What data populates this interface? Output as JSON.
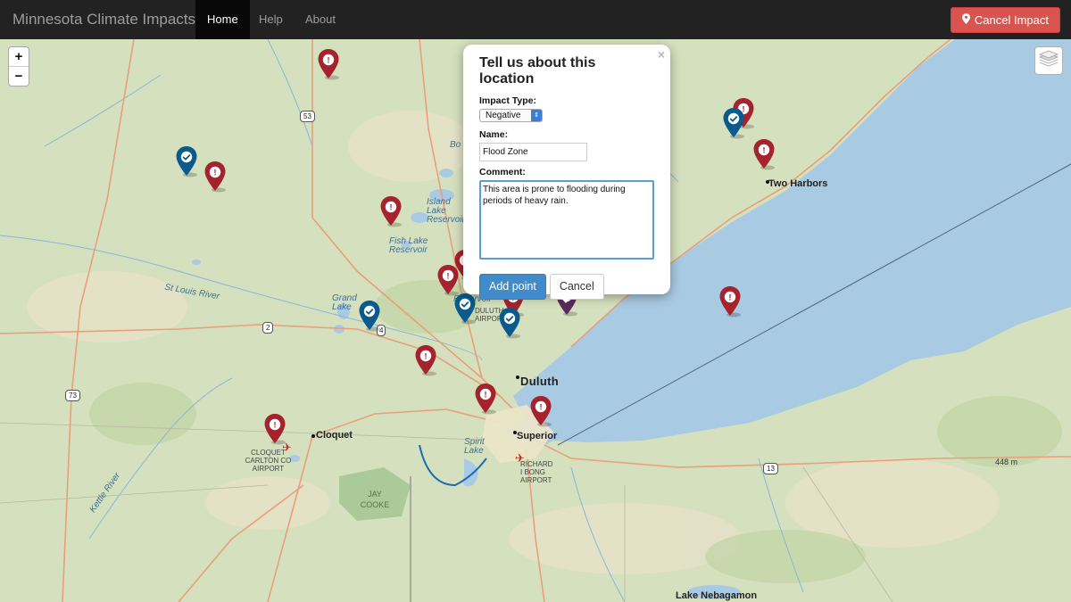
{
  "app": {
    "brand": "Minnesota Climate Impacts",
    "nav": [
      {
        "label": "Home",
        "active": true
      },
      {
        "label": "Help",
        "active": false
      },
      {
        "label": "About",
        "active": false
      }
    ],
    "cancel_button": {
      "label": "Cancel Impact",
      "icon": "map-marker-icon",
      "color": "#d9534f"
    }
  },
  "map": {
    "zoom_in": "+",
    "zoom_out": "−",
    "layers_icon": "layers-icon",
    "labels": {
      "duluth": "Duluth",
      "two_harbors": "Two Harbors",
      "cloquet": "Cloquet",
      "superior": "Superior",
      "lake_nebagamon": "Lake Nebagamon",
      "elevation": "448 m",
      "st_louis_river": "St Louis River",
      "kettle_river": "Kettle River",
      "grand_lake": "Grand Lake",
      "island_lake": "Island Lake Reservoir",
      "fish_lake": "Fish Lake Reservoir",
      "spirit_lake": "Spirit Lake",
      "jay_cooke": "JAY COOKE",
      "cloquet_airport": "CLOQUET CARLTON CO AIRPORT",
      "richard_bong": "RICHARD I BONG AIRPORT",
      "duluth_airport": "DULUTH AIRPORT",
      "reservoir_fragment": "Reservoir",
      "bo_fragment": "Bo"
    },
    "shields": {
      "hwy53": "53",
      "hwy2": "2",
      "hwy4": "4",
      "hwy73": "73",
      "hwy13": "13"
    },
    "colors": {
      "negative": "#a4232c",
      "positive": "#0b5a8e",
      "pending": "#5b2a5c",
      "water": "#a8cae3",
      "land": "#d5e0be"
    }
  },
  "popup": {
    "title": "Tell us about this location",
    "close": "×",
    "impact_type_label": "Impact Type:",
    "impact_type_value": "Negative",
    "name_label": "Name:",
    "name_value": "Flood Zone",
    "comment_label": "Comment:",
    "comment_value": "This area is prone to flooding during periods of heavy rain.",
    "add_button": "Add point",
    "cancel_button": "Cancel"
  }
}
